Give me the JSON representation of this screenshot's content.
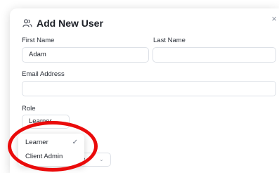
{
  "modal": {
    "title": "Add New User",
    "title_icon": "users-icon",
    "close_icon": "close-icon",
    "close_glyph": "×"
  },
  "form": {
    "first_name_label": "First Name",
    "first_name_value": "Adam",
    "last_name_label": "Last Name",
    "last_name_value": "",
    "email_label": "Email Address",
    "email_value": "",
    "role_label": "Role",
    "role_value": "Learner"
  },
  "role_dropdown": {
    "options": [
      {
        "label": "Learner",
        "selected": true
      },
      {
        "label": "Client Admin",
        "selected": false
      }
    ],
    "check_glyph": "✓"
  },
  "partial_control": {
    "visible_text": "e"
  },
  "colors": {
    "annotation": "#ea0b0b",
    "title": "#1c1f26"
  }
}
